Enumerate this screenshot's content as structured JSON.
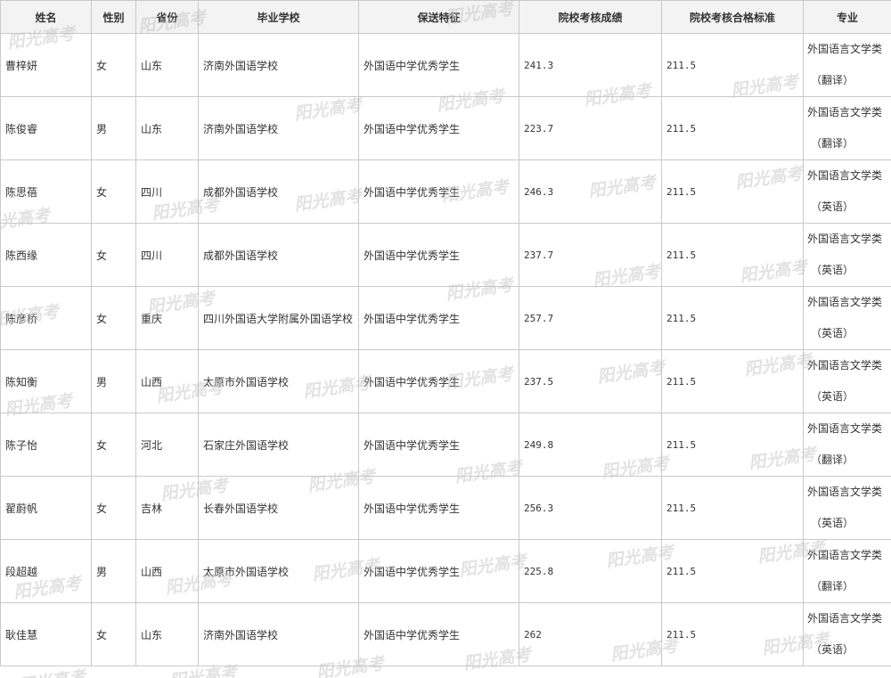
{
  "table": {
    "headers": [
      "姓名",
      "性别",
      "省份",
      "毕业学校",
      "保送特征",
      "院校考核成绩",
      "院校考核合格标准",
      "专业"
    ],
    "rows": [
      {
        "name": "曹梓妍",
        "gender": "女",
        "province": "山东",
        "school": "济南外国语学校",
        "feature": "外国语中学优秀学生",
        "score": "241.3",
        "standard": "211.5",
        "major1": "外国语言文学类",
        "major2": "（翻译）"
      },
      {
        "name": "陈俊睿",
        "gender": "男",
        "province": "山东",
        "school": "济南外国语学校",
        "feature": "外国语中学优秀学生",
        "score": "223.7",
        "standard": "211.5",
        "major1": "外国语言文学类",
        "major2": "（翻译）"
      },
      {
        "name": "陈思蓓",
        "gender": "女",
        "province": "四川",
        "school": "成都外国语学校",
        "feature": "外国语中学优秀学生",
        "score": "246.3",
        "standard": "211.5",
        "major1": "外国语言文学类",
        "major2": "（英语）"
      },
      {
        "name": "陈西缘",
        "gender": "女",
        "province": "四川",
        "school": "成都外国语学校",
        "feature": "外国语中学优秀学生",
        "score": "237.7",
        "standard": "211.5",
        "major1": "外国语言文学类",
        "major2": "（英语）"
      },
      {
        "name": "陈彦桥",
        "gender": "女",
        "province": "重庆",
        "school": "四川外国语大学附属外国语学校",
        "feature": "外国语中学优秀学生",
        "score": "257.7",
        "standard": "211.5",
        "major1": "外国语言文学类",
        "major2": "（英语）"
      },
      {
        "name": "陈知衡",
        "gender": "男",
        "province": "山西",
        "school": "太原市外国语学校",
        "feature": "外国语中学优秀学生",
        "score": "237.5",
        "standard": "211.5",
        "major1": "外国语言文学类",
        "major2": "（英语）"
      },
      {
        "name": "陈子怡",
        "gender": "女",
        "province": "河北",
        "school": "石家庄外国语学校",
        "feature": "外国语中学优秀学生",
        "score": "249.8",
        "standard": "211.5",
        "major1": "外国语言文学类",
        "major2": "（翻译）"
      },
      {
        "name": "翟蔚帆",
        "gender": "女",
        "province": "吉林",
        "school": "长春外国语学校",
        "feature": "外国语中学优秀学生",
        "score": "256.3",
        "standard": "211.5",
        "major1": "外国语言文学类",
        "major2": "（英语）"
      },
      {
        "name": "段超越",
        "gender": "男",
        "province": "山西",
        "school": "太原市外国语学校",
        "feature": "外国语中学优秀学生",
        "score": "225.8",
        "standard": "211.5",
        "major1": "外国语言文学类",
        "major2": "（翻译）"
      },
      {
        "name": "耿佳慧",
        "gender": "女",
        "province": "山东",
        "school": "济南外国语学校",
        "feature": "外国语中学优秀学生",
        "score": "262",
        "standard": "211.5",
        "major1": "外国语言文学类",
        "major2": "（英语）"
      }
    ]
  },
  "watermark": {
    "text": "阳光高考"
  }
}
